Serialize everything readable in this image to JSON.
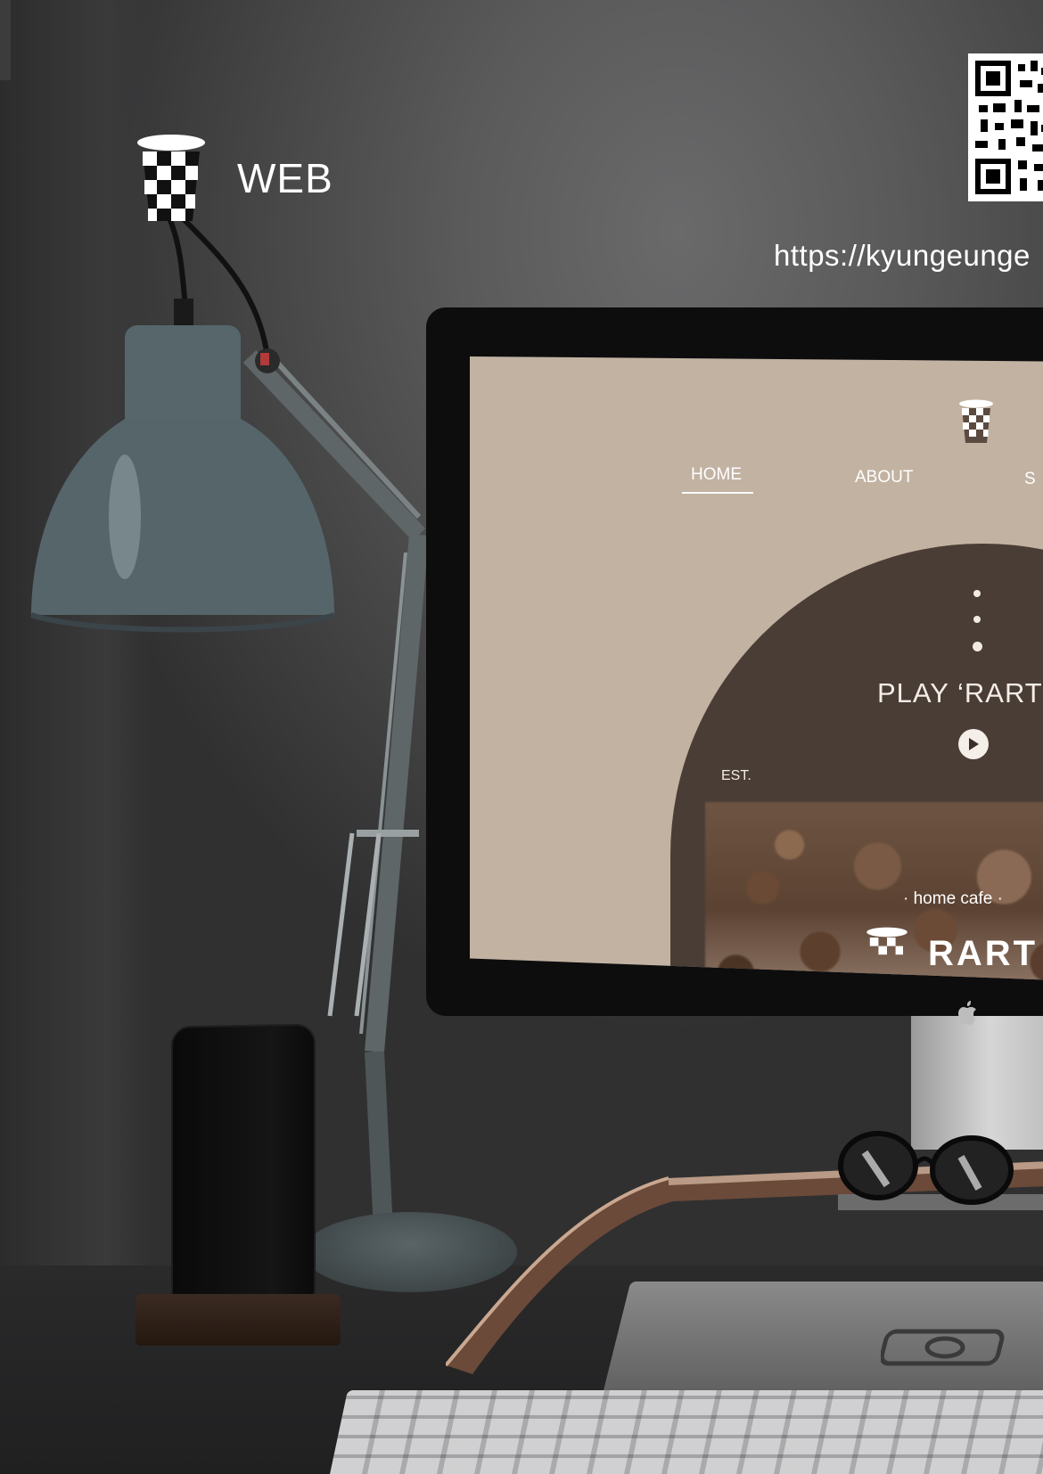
{
  "header": {
    "brand_label": "WEB",
    "url_text": "https://kyungeunge"
  },
  "site": {
    "nav": {
      "items": [
        {
          "label": "HOME"
        },
        {
          "label": "ABOUT"
        },
        {
          "label": "S"
        }
      ]
    },
    "hero": {
      "title": "PLAY ‘RART",
      "est_label": "EST.",
      "photo_subtitle": "· home cafe ·",
      "photo_brand": "RART"
    }
  },
  "icons": {
    "brand_logo": "checkered-cup-icon",
    "play": "play-icon",
    "apple": "apple-logo-icon",
    "qr": "qr-code-icon"
  },
  "colors": {
    "screen_bg": "#c2b2a2",
    "arch_bg": "#4a3d35",
    "text_light": "#f4eee8"
  }
}
